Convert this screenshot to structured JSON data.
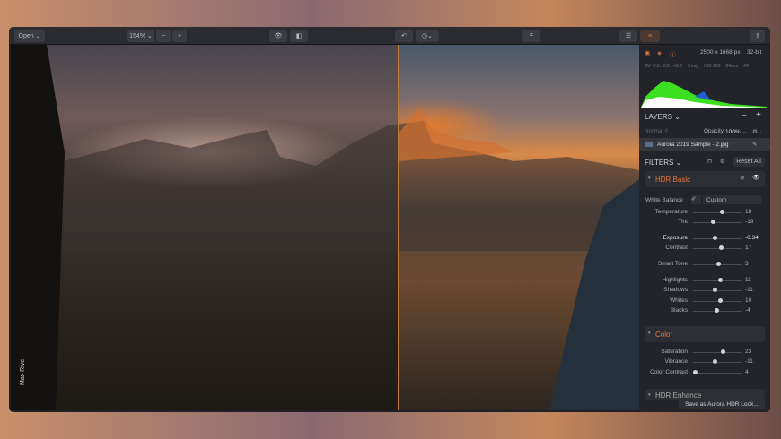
{
  "toolbar": {
    "open": "Open ⌄",
    "zoom": "154% ⌄",
    "minus": "−",
    "plus": "+"
  },
  "image": {
    "credit": "Max Rive"
  },
  "info": {
    "dimensions": "2500 x 1668 px",
    "bit_depth": "32-bit",
    "ev": "EV -2.0...0.0...+2.0",
    "images": "3 img",
    "iso": "ISO 200",
    "focal": "24mm",
    "aperture": "f/4"
  },
  "layers": {
    "title": "LAYERS ⌄",
    "blend": "Normal ◊",
    "opacity_label": "Opacity:",
    "opacity": "100% ⌄",
    "layer_name": "Aurora 2019 Sample - 2.jpg"
  },
  "filters": {
    "title": "FILTERS ⌄",
    "reset": "Reset All"
  },
  "hdr_basic": {
    "title": "HDR Basic",
    "wb_label": "White Balance",
    "wb_value": "Custom",
    "sliders": [
      {
        "label": "Temperature",
        "value": "18",
        "pos": 0.6
      },
      {
        "label": "Tint",
        "value": "-19",
        "pos": 0.4
      },
      {
        "label": "Exposure",
        "value": "-0.34",
        "pos": 0.45
      },
      {
        "label": "Contrast",
        "value": "17",
        "pos": 0.58
      },
      {
        "label": "Smart Tone",
        "value": "3",
        "pos": 0.52
      },
      {
        "label": "Highlights",
        "value": "11",
        "pos": 0.56
      },
      {
        "label": "Shadows",
        "value": "-11",
        "pos": 0.44
      },
      {
        "label": "Whites",
        "value": "10",
        "pos": 0.55
      },
      {
        "label": "Blacks",
        "value": "-4",
        "pos": 0.48
      }
    ]
  },
  "color": {
    "title": "Color",
    "sliders": [
      {
        "label": "Saturation",
        "value": "23",
        "pos": 0.62
      },
      {
        "label": "Vibrance",
        "value": "-11",
        "pos": 0.44
      },
      {
        "label": "Color Contrast",
        "value": "4",
        "pos": 0.04
      }
    ]
  },
  "hdr_enhance": {
    "title": "HDR Enhance"
  },
  "save_look": "Save as Aurora HDR Look..."
}
